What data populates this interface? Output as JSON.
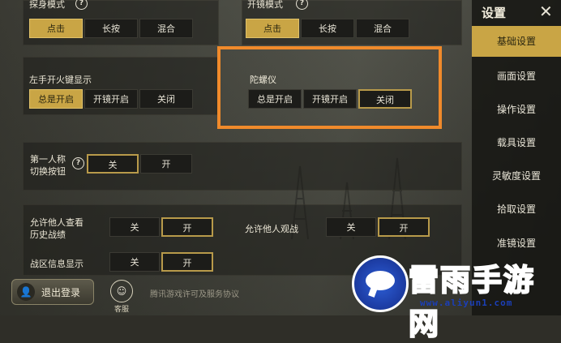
{
  "sections": {
    "probe_mode": {
      "label": "探身模式",
      "options": [
        "点击",
        "长按",
        "混合"
      ],
      "selected": 0
    },
    "scope_mode": {
      "label": "开镜模式",
      "options": [
        "点击",
        "长按",
        "混合"
      ],
      "selected": 0
    },
    "left_fire": {
      "label": "左手开火键显示",
      "options": [
        "总是开启",
        "开镜开启",
        "关闭"
      ],
      "selected": 0
    },
    "gyroscope": {
      "label": "陀螺仪",
      "options": [
        "总是开启",
        "开镜开启",
        "关闭"
      ],
      "selected": 2
    },
    "first_person": {
      "label_line1": "第一人称",
      "label_line2": "切换按钮",
      "options": [
        "关",
        "开"
      ],
      "selected": 0
    },
    "view_history": {
      "label_line1": "允许他人查看",
      "label_line2": "历史战绩",
      "options": [
        "关",
        "开"
      ],
      "selected": 1
    },
    "allow_watch": {
      "label": "允许他人观战",
      "options": [
        "关",
        "开"
      ],
      "selected": 1
    },
    "zone_info": {
      "label": "战区信息显示",
      "options": [
        "关",
        "开"
      ],
      "selected": 1
    }
  },
  "sidebar": {
    "title": "设置",
    "close": "✕",
    "items": [
      "基础设置",
      "画面设置",
      "操作设置",
      "载具设置",
      "灵敏度设置",
      "拾取设置",
      "准镜设置"
    ],
    "active": 0
  },
  "footer": {
    "logout": "退出登录",
    "service": "客服",
    "license": "腾讯游戏许可及服务协议"
  },
  "watermark": {
    "name": "雷雨手游网",
    "url": "www.aliyun1.com"
  },
  "colors": {
    "accent": "#c9a545",
    "highlight": "#f08a2b"
  }
}
